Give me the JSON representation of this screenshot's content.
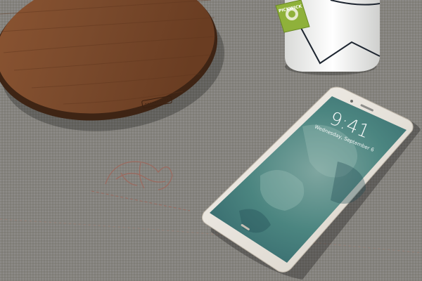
{
  "scene": {
    "lockscreen": {
      "time": "9:41",
      "date": "Wednesday, September 6"
    },
    "tea_tag": {
      "brand": "PICKWICK"
    },
    "board_stamp": {
      "text": ""
    },
    "embroidery": {
      "text": ""
    }
  },
  "colors": {
    "tablecloth": "#8d8b85",
    "board_wood": "#7a4a2c",
    "board_edge": "#3e2414",
    "phone_body": "#e9e4dc",
    "screen_teal": "#3f7a78",
    "tea_tag_green": "#8fb13a",
    "mug_white": "#f4f4f2",
    "embroidery_rust": "#a0665a"
  }
}
